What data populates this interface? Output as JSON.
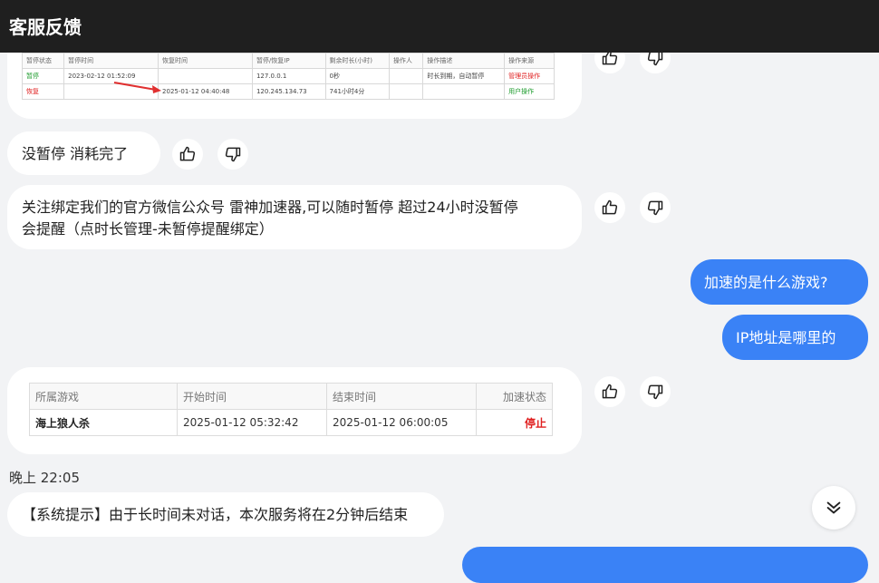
{
  "header": {
    "title": "客服反馈"
  },
  "table_small": {
    "headers": [
      "暂停状态",
      "暂停时间",
      "恢复时间",
      "暂停/恢复IP",
      "剩余时长(小时)",
      "操作人",
      "操作描述",
      "操作来源"
    ],
    "rows": [
      [
        "暂停",
        "2023-02-12 01:52:09",
        "",
        "127.0.0.1",
        "0秒",
        "",
        "时长到期，自动暂停",
        "管理员操作"
      ],
      [
        "恢复",
        "",
        "2025-01-12 04:40:48",
        "120.245.134.73",
        "741小时4分",
        "",
        "",
        "用户操作"
      ]
    ]
  },
  "messages": {
    "m1": "没暂停 消耗完了",
    "m2_line1": "关注绑定我们的官方微信公众号 雷神加速器,可以随时暂停  超过24小时没暂停",
    "m2_line2": "会提醒（点时长管理-未暂停提醒绑定）",
    "u1": "加速的是什么游戏?",
    "u2": "IP地址是哪里的",
    "m4": "【系统提示】由于长时间未对话，本次服务将在2分钟后结束"
  },
  "table_game": {
    "headers": [
      "所属游戏",
      "开始时间",
      "结束时间",
      "加速状态"
    ],
    "row": [
      "海上狼人杀",
      "2025-01-12 05:32:42",
      "2025-01-12 06:00:05",
      "停止"
    ]
  },
  "time_label": "晚上 22:05",
  "icons": {
    "like": "thumbs-up-icon",
    "dislike": "thumbs-down-icon",
    "scroll": "chevron-double-down-icon"
  },
  "colors": {
    "accent": "#3a82f6",
    "header_bg": "#1f1f1f",
    "stop": "#e02020"
  }
}
